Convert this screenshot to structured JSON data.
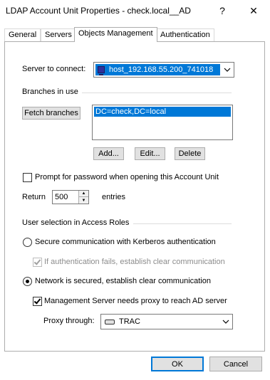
{
  "window": {
    "title": "LDAP Account Unit Properties - check.local__AD",
    "help_glyph": "?",
    "close_glyph": "✕"
  },
  "tabs": [
    {
      "label": "General"
    },
    {
      "label": "Servers"
    },
    {
      "label": "Objects Management"
    },
    {
      "label": "Authentication"
    }
  ],
  "server": {
    "label": "Server to connect:",
    "value": "host_192.168.55.200_741018",
    "icon": "server-icon"
  },
  "branches": {
    "group_label": "Branches in use",
    "fetch_label": "Fetch branches",
    "items": [
      "DC=check,DC=local"
    ],
    "add_label": "Add...",
    "edit_label": "Edit...",
    "delete_label": "Delete"
  },
  "prompt_password": {
    "label": "Prompt for password when opening this Account Unit",
    "checked": false
  },
  "return_entries": {
    "label_before": "Return",
    "value": "500",
    "label_after": "entries"
  },
  "access_roles": {
    "group_label": "User selection in Access Roles",
    "secure_label": "Secure communication with Kerberos authentication",
    "fallback_label": "If authentication fails, establish clear communication",
    "network_label": "Network is secured, establish clear communication",
    "proxy_needed_label": "Management Server needs proxy to reach AD server",
    "proxy_through_label": "Proxy through:",
    "proxy_value": "TRAC",
    "selected": "network"
  },
  "footer": {
    "ok_label": "OK",
    "cancel_label": "Cancel"
  },
  "colors": {
    "selection": "#0078d7",
    "button_bg": "#e1e1e1"
  }
}
